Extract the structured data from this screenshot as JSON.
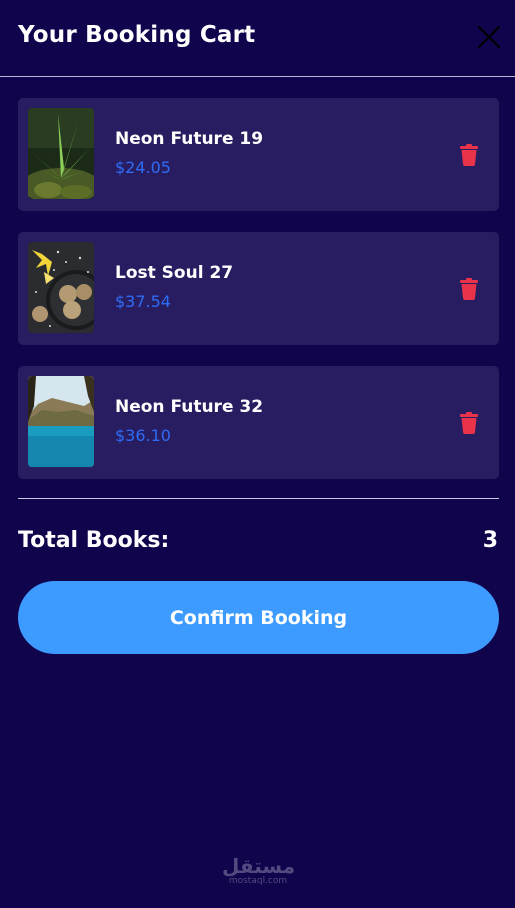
{
  "header": {
    "title": "Your Booking Cart",
    "close_icon": "close-icon"
  },
  "cart": {
    "items": [
      {
        "title": "Neon Future 19",
        "price": "$24.05",
        "image": "plant-photo",
        "delete_icon": "trash-icon"
      },
      {
        "title": "Lost Soul 27",
        "price": "$37.54",
        "image": "cookies-photo",
        "delete_icon": "trash-icon"
      },
      {
        "title": "Neon Future 32",
        "price": "$36.10",
        "image": "sea-cliff-photo",
        "delete_icon": "trash-icon"
      }
    ]
  },
  "summary": {
    "total_label": "Total Books:",
    "total_value": "3"
  },
  "actions": {
    "confirm_label": "Confirm Booking"
  },
  "watermark": {
    "arabic": "مستقل",
    "latin": "mostaql.com"
  },
  "colors": {
    "background": "#10044d",
    "card": "#271d60",
    "price": "#2f6cf6",
    "delete": "#e8334a",
    "button": "#3d9bff"
  }
}
